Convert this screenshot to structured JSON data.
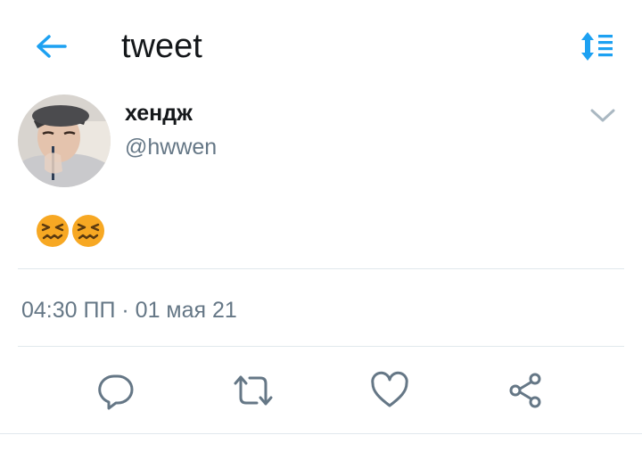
{
  "header": {
    "title": "tweet",
    "back_icon": "arrow-left-icon",
    "sort_icon": "sort-list-icon",
    "accent_color": "#1da1f2"
  },
  "tweet": {
    "author": {
      "display_name": "хендж",
      "handle": "@hwwen"
    },
    "menu_icon": "chevron-down-icon",
    "content": {
      "emoji": [
        "face-with-tightly-closed-eyes",
        "face-with-tightly-closed-eyes"
      ]
    },
    "timestamp": {
      "time": "04:30 ПП",
      "separator": " · ",
      "date": "01 мая 21"
    },
    "actions": [
      {
        "name": "reply",
        "icon": "speech-bubble-icon"
      },
      {
        "name": "retweet",
        "icon": "retweet-icon"
      },
      {
        "name": "like",
        "icon": "heart-icon"
      },
      {
        "name": "share",
        "icon": "share-nodes-icon"
      }
    ]
  },
  "colors": {
    "text_primary": "#14171a",
    "text_secondary": "#657786",
    "divider": "#e1e8ed",
    "emoji_face": "#f7a823"
  }
}
